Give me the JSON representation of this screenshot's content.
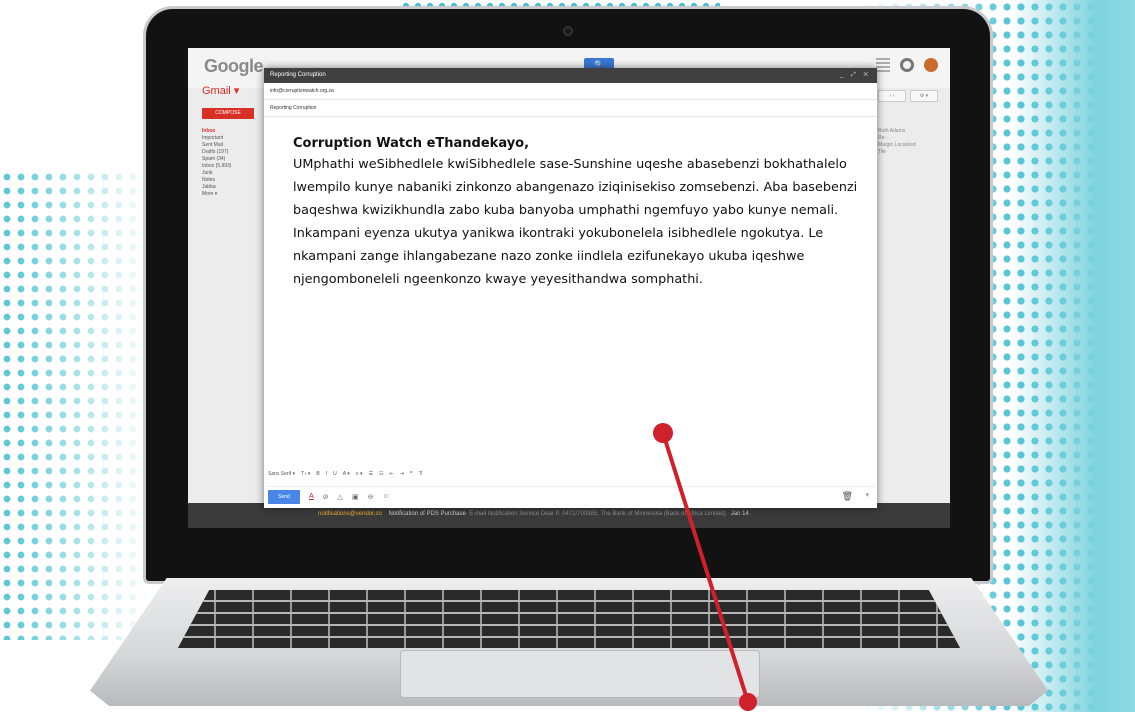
{
  "browser": {
    "logo": "Google",
    "search_glyph": "🔍"
  },
  "gmail": {
    "label": "Gmail ▾",
    "compose_label": "COMPOSE",
    "nav": [
      "Inbox",
      "Important",
      "Sent Mail",
      "Drafts (197)",
      "Spam (34)",
      "Inbox (5,993)",
      "Junk",
      "Notes",
      "Jabba",
      "More ▾"
    ],
    "right_controls": [
      "‹ ›",
      "⚙ ▾"
    ],
    "right_text": [
      "Ruth Adams",
      "Re: ..",
      "Margin Localized",
      "Tile"
    ],
    "bottom_row": {
      "sender": "notifications@vendor.co",
      "subject": "Notification of PDS Purchase",
      "snippet": "E-mail Notification Service Dear P. 0472/700985; The Bank of Minnesota (Bank of Africa Limited)",
      "date": "Jan 14"
    }
  },
  "compose": {
    "title": "Reporting Corruption",
    "window_controls": "_ ⤢ ✕",
    "to": "info@corruptionwatch.org.za",
    "subject": "Reporting Corruption",
    "greeting": "Corruption Watch eThandekayo,",
    "body": "UMphathi weSibhedlele kwiSibhedlele sase-Sunshine uqeshe abasebenzi bokhathalelo lwempilo kunye nabaniki zinkonzo abangenazo iziqinisekiso zomsebenzi. Aba basebenzi baqeshwa kwizikhundla zabo kuba banyoba umphathi ngemfuyo yabo kunye nemali. Inkampani eyenza ukutya yanikwa ikontraki yokubonelela isibhedlele ngokutya. Le nkampani zange ihlangabezane nazo zonke iindlela ezifunekayo ukuba iqeshwe njengomboneleli ngeenkonzo kwaye yeyesithandwa somphathi.",
    "format_bar": [
      "Sans Serif ▾",
      "T↕ ▾",
      "B",
      "I",
      "U",
      "A ▾",
      "≡ ▾",
      "☰",
      "☷",
      "⇤",
      "⇥",
      "❞",
      "T̸"
    ],
    "send_label": "Send",
    "tools": [
      "A",
      "⊘",
      "△",
      "▣",
      "⊖",
      "☺"
    ],
    "trash": "🗑",
    "more": "▾"
  },
  "colors": {
    "accent_teal": "#43bfd0",
    "pointer_red": "#d0202c",
    "send_blue": "#4a85e8",
    "gmail_red": "#d93025"
  }
}
